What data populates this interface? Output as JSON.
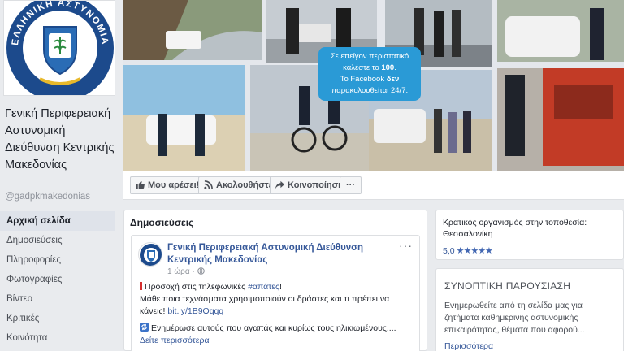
{
  "page": {
    "name": "Γενική Περιφερειακή Αστυνομική Διεύθυνση Κεντρικής Μακεδονίας",
    "handle": "@gadpkmakedonias",
    "logo_text": "ΕΛΛΗΝΙΚΗ ΑΣΤΥΝΟΜΙΑ"
  },
  "cover": {
    "note_line1": "Σε επείγον περιστατικό",
    "note_line2_pre": "καλέστε το ",
    "note_line2_num": "100",
    "note_line3_pre": "Το Facebook ",
    "note_line3_bold": "δεν",
    "note_line4": "παρακολουθείται 24/7."
  },
  "actions": {
    "like": "Μου αρέσει!",
    "follow": "Ακολουθήστε",
    "share": "Κοινοποίηση",
    "more": "···"
  },
  "nav": [
    {
      "label": "Αρχική σελίδα",
      "active": true
    },
    {
      "label": "Δημοσιεύσεις"
    },
    {
      "label": "Πληροφορίες"
    },
    {
      "label": "Φωτογραφίες"
    },
    {
      "label": "Βίντεο"
    },
    {
      "label": "Κριτικές"
    },
    {
      "label": "Κοινότητα"
    }
  ],
  "posts": {
    "title": "Δημοσιεύσεις",
    "post": {
      "author": "Γενική Περιφερειακή Αστυνομική Διεύθυνση Κεντρικής Μακεδονίας",
      "time": "1 ώρα · ",
      "line1_pre": "Προσοχή στις τηλεφωνικές ",
      "line1_tag": "#απάτες",
      "line1_post": "!",
      "line2": "Μάθε ποια τεχνάσματα χρησιμοποιούν οι δράστες και τι πρέπει να κάνεις! ",
      "line2_link": "bit.ly/1B9Oqqq",
      "line3": "Ενημέρωσε αυτούς που αγαπάς και κυρίως τους ηλικιωμένους....",
      "see_more": "Δείτε περισσότερα",
      "more": "···"
    }
  },
  "info": {
    "text": "Κρατικός οργανισμός στην τοποθεσία: Θεσσαλονίκη",
    "rating": "5,0",
    "stars": "★★★★★"
  },
  "about": {
    "title": "ΣΥΝΟΠΤΙΚΗ ΠΑΡΟΥΣΙΑΣΗ",
    "text": "Ενημερωθείτε από τη σελίδα μας για ζητήματα καθημερινής αστυνομικής επικαιρότητας, θέματα που αφορού...",
    "more": "Περισσότερα"
  },
  "colors": {
    "brand_blue": "#1c4a8c",
    "link": "#365899",
    "note_blue": "#2a9ad6"
  }
}
